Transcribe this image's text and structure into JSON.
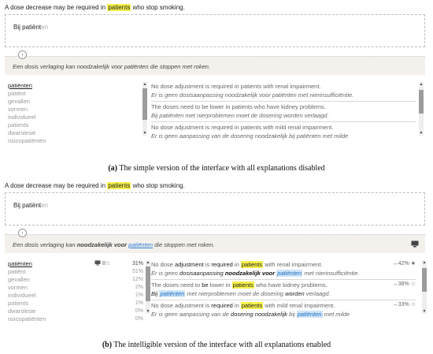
{
  "panel_a": {
    "source": {
      "before": "A dose decrease may be required in ",
      "highlight": "patients",
      "after": " who stop smoking."
    },
    "editor": {
      "typed": "Bij patiënt",
      "rest": "en"
    },
    "suggestion": "Een dosis verlaging kan noodzakelijk voor patiënten die stoppen met roken.",
    "alternatives": [
      "patiënten",
      "patiënt",
      "gevallen",
      "vormen",
      "individueel",
      "patients",
      "dwarslesie",
      "nsicopatiënten"
    ],
    "examples": [
      {
        "en": "No dose adjustment is required in patients with renal impairment.",
        "nl": "Er is geen dosisaanpassing noodzakelijk voor patiënten met nierinsufficiëntie."
      },
      {
        "en": "The doses need to be lower in patients who have kidney problems.",
        "nl": "Bij patiënten met nierproblemen moet de dosering worden verlaagd."
      },
      {
        "en": "No dose adjustment is required in patients with mild renal impairment.",
        "nl": "Er is geen aanpassing van de dosering noodzakelijk bij patiënten met milde"
      }
    ],
    "caption": {
      "label": "(a)",
      "text": " The simple version of the interface with all explanations disabled"
    }
  },
  "panel_b": {
    "source": {
      "before": "A dose decrease may be required in ",
      "highlight": "patients",
      "after": " who stop smoking."
    },
    "editor": {
      "typed": "Bij patiënt",
      "rest": "en"
    },
    "suggestion": {
      "p1": "Een dosis verlaging kan ",
      "p2": "noodzakelijk voor",
      "p3": " ",
      "p4": "patiënten",
      "p5": " die stoppen met roken."
    },
    "alternatives": [
      {
        "label": "patiënten",
        "meta": "8☆",
        "pct": "31%"
      },
      {
        "label": "patiënt",
        "pct": "51%"
      },
      {
        "label": "gevallen",
        "pct": "12%"
      },
      {
        "label": "vormen",
        "pct": "2%"
      },
      {
        "label": "individueel",
        "pct": "1%"
      },
      {
        "label": "patients",
        "pct": "1%"
      },
      {
        "label": "dwarslesie",
        "pct": "0%"
      },
      {
        "label": "nsicopatiënten",
        "pct": "0%"
      }
    ],
    "examples": [
      {
        "en": {
          "a": "No dose ",
          "b": "adjustment",
          "c": " is ",
          "d": "required",
          "e": " in ",
          "f": "patients",
          "g": " with renal impairment."
        },
        "nl": {
          "a": "Er is geen ",
          "b": "dosisaanpassing",
          "c": " ",
          "d": "noodzakelijk voor",
          "e": " ",
          "f": "patiënten",
          "g": " met nierinsufficiëntie."
        },
        "score": "↔42% ★"
      },
      {
        "en": {
          "a": "The doses need to ",
          "b": "be",
          "c": " lower in ",
          "d": "patients",
          "e": " who have kidney problems."
        },
        "nl": {
          "a": "",
          "b": "Bij",
          "c": " ",
          "d": "patiënten",
          "e": " met nierproblemen moet de dosering ",
          "f": "worden",
          "g": " verlaagd."
        },
        "score": "↔38% ☆"
      },
      {
        "en": {
          "a": "No dose adjustment is ",
          "b": "required",
          "c": " in ",
          "d": "patients",
          "e": " with mild renal impairment."
        },
        "nl": {
          "a": "Er is geen aanpassing van de ",
          "b": "dosering",
          "c": " ",
          "d": "noodzakelijk",
          "e": " bij ",
          "f": "patiënten",
          "g": " met milde"
        },
        "score": "↔33% ☆"
      }
    ],
    "caption": {
      "label": "(b)",
      "text": " The intelligible version of the interface with all explanations enabled"
    }
  }
}
